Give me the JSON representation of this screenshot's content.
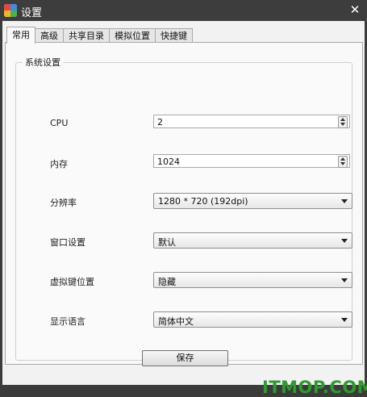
{
  "window": {
    "title": "设置",
    "icon": "app-icon",
    "close_icon": "close-icon",
    "close_glyph": "✕"
  },
  "tabs": [
    {
      "label": "常用",
      "active": true
    },
    {
      "label": "高级",
      "active": false
    },
    {
      "label": "共享目录",
      "active": false
    },
    {
      "label": "模拟位置",
      "active": false
    },
    {
      "label": "快捷键",
      "active": false
    }
  ],
  "group": {
    "title": "系统设置",
    "cpu": {
      "label": "CPU",
      "value": "2"
    },
    "memory": {
      "label": "内存",
      "value": "1024"
    },
    "resolution": {
      "label": "分辨率",
      "selected": "1280 * 720 (192dpi)"
    },
    "window_setting": {
      "label": "窗口设置",
      "selected": "默认"
    },
    "virtual_key_position": {
      "label": "虚拟键位置",
      "selected": "隐藏"
    },
    "display_language": {
      "label": "显示语言",
      "selected": "简体中文"
    }
  },
  "save_label": "保存",
  "watermark": "ITMOP.COM",
  "colors": {
    "titlebar": "#3d3d3d",
    "panel": "#f9f9f9",
    "watermark": "#2f9a2f"
  }
}
